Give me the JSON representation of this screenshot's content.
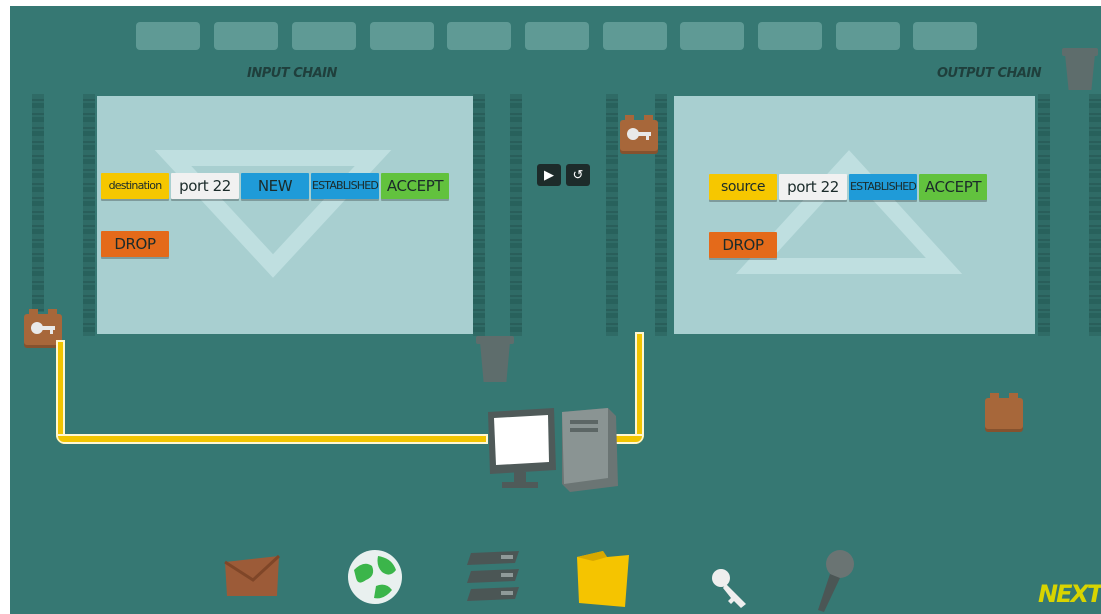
{
  "slots_count": 11,
  "chains": {
    "input_title": "INPUT CHAIN",
    "output_title": "OUTPUT CHAIN"
  },
  "input_rules": {
    "row1": [
      "destination",
      "port 22",
      "NEW",
      "ESTABLISHED",
      "ACCEPT"
    ],
    "row2": [
      "DROP"
    ]
  },
  "output_rules": {
    "row1": [
      "source",
      "port 22",
      "ESTABLISHED",
      "ACCEPT"
    ],
    "row2": [
      "DROP"
    ]
  },
  "controls": {
    "play_icon": "▶",
    "reset_icon": "↺"
  },
  "toolbar": {
    "items": [
      "envelope-icon",
      "globe-icon",
      "server-rack-icon",
      "folder-icon",
      "key-icon",
      "microphone-icon"
    ]
  },
  "next_label": "NEXT",
  "colors": {
    "background": "#367873",
    "panel": "#a8cfd0",
    "wire": "#f2c500",
    "condition_yellow": "#f6c700",
    "state_blue": "#1f9bd8",
    "accept_green": "#62c23e",
    "drop_orange": "#e46a1a"
  }
}
